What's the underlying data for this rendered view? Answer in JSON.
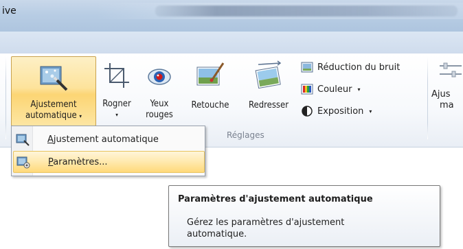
{
  "window": {
    "title": "ive"
  },
  "ribbon": {
    "buttons": [
      {
        "name": "ajustement",
        "line1": "Ajustement",
        "line2": "automatique"
      },
      {
        "name": "rogner",
        "line1": "Rogner",
        "line2": ""
      },
      {
        "name": "yeux",
        "line1": "Yeux",
        "line2": "rouges"
      },
      {
        "name": "retouche",
        "line1": "Retouche",
        "line2": ""
      },
      {
        "name": "redresser",
        "line1": "Redresser",
        "line2": ""
      }
    ],
    "small_buttons": [
      {
        "label": "Réduction du bruit"
      },
      {
        "label": "Couleur"
      },
      {
        "label": "Exposition"
      }
    ],
    "group_label": "Réglages",
    "right_button": {
      "line1": "Ajus",
      "line2": "ma"
    }
  },
  "menu": {
    "items": [
      {
        "accel": "A",
        "rest": "justement automatique"
      },
      {
        "accel": "P",
        "rest": "aramètres..."
      }
    ]
  },
  "tooltip": {
    "title": "Paramètres d'ajustement automatique",
    "description": "Gérez les paramètres d'ajustement automatique."
  },
  "colors": {
    "accent": "#fcd574",
    "ribbon_border": "#9eb4cf"
  }
}
